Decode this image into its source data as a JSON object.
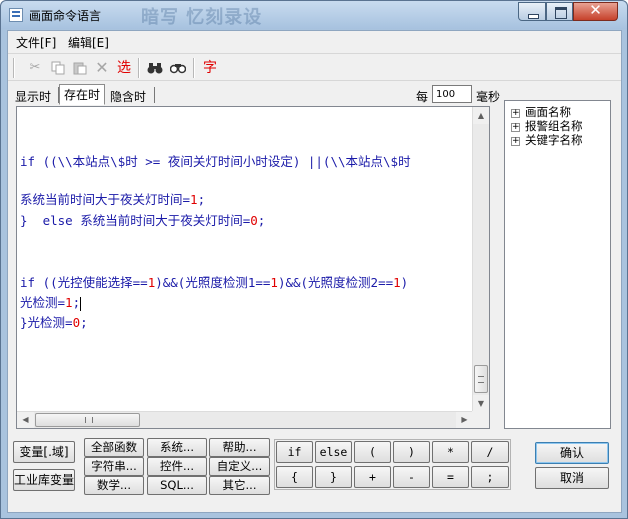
{
  "window": {
    "title": "画面命令语言",
    "title_ghost": "暗写 忆刻录设"
  },
  "menu": {
    "file": "文件[F]",
    "edit": "编辑[E]"
  },
  "toolbar": {
    "cut_icon": "scissors-icon",
    "copy_icon": "copy-icon",
    "paste_icon": "paste-icon",
    "delete_icon": "delete-x-icon",
    "select_label": "选",
    "find_icon": "binoculars-icon",
    "replace_icon": "binoculars-replace-icon",
    "font_label": "字"
  },
  "tabs": {
    "show": "显示时",
    "exist": "存在时",
    "hide": "隐含时"
  },
  "interval": {
    "every_label": "每",
    "value": "100",
    "unit_label": "毫秒"
  },
  "code": {
    "line1": "if ((\\\\本站点\\$时 >= 夜间关灯时间小时设定) ||(\\\\本站点\\$时",
    "line2a": "系统当前时间大于夜关灯时间=",
    "line2b": "1",
    "line2c": ";",
    "line3a": "}  ",
    "line3b": "else",
    "line3c": " 系统当前时间大于夜关灯时间=",
    "line3d": "0",
    "line3e": ";",
    "line4a": "if ((光控使能选择==",
    "line4b": "1",
    "line4c": ")&&(光照度检测1==",
    "line4d": "1",
    "line4e": ")&&(光照度检测2==",
    "line4f": "1",
    "line4g": ")",
    "line5a": "光检测=",
    "line5b": "1",
    "line5c": ";",
    "line6a": "}光检测=",
    "line6b": "0",
    "line6c": ";"
  },
  "tree": {
    "items": [
      "画面名称",
      "报警组名称",
      "关键字名称"
    ],
    "expander": "+"
  },
  "buttons": {
    "variable": "变量[.域]",
    "industrial_lib_var": "工业库变量",
    "all_functions": "全部函数",
    "system": "系统...",
    "help": "帮助...",
    "string": "字符串...",
    "control": "控件...",
    "custom": "自定义...",
    "math": "数学...",
    "sql": "SQL...",
    "other": "其它...",
    "ok": "确认",
    "cancel": "取消"
  },
  "operators": {
    "row1": [
      "if",
      "else",
      "(",
      ")",
      "*",
      "/"
    ],
    "row2": [
      "{",
      "}",
      "+",
      "-",
      "=",
      ";"
    ]
  }
}
